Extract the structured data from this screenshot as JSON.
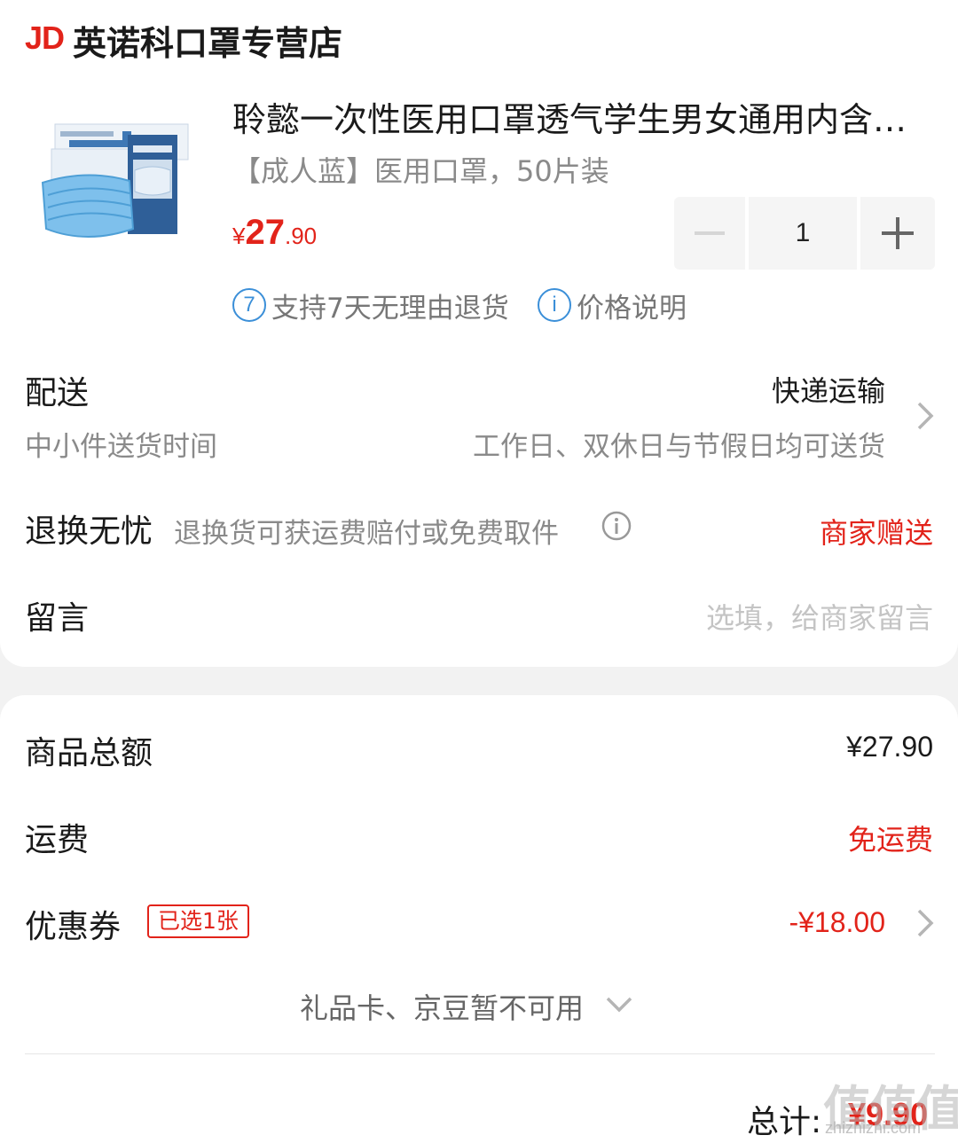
{
  "shop": {
    "logo": "JD",
    "name": "英诺科口罩专营店"
  },
  "product": {
    "title": "聆懿一次性医用口罩透气学生男女通用内含…",
    "spec": "【成人蓝】医用口罩，50片装",
    "price_symbol": "¥",
    "price_int": "27",
    "price_dec": ".90",
    "quantity": "1",
    "services": [
      {
        "icon_text": "7",
        "label": "支持7天无理由退货"
      },
      {
        "icon_text": "i",
        "label": "价格说明"
      }
    ]
  },
  "delivery": {
    "label": "配送",
    "value": "快递运输",
    "sub_label": "中小件送货时间",
    "sub_value": "工作日、双休日与节假日均可送货"
  },
  "returns": {
    "label": "退换无忧",
    "desc": "退换货可获运费赔付或免费取件",
    "value": "商家赠送"
  },
  "message": {
    "label": "留言",
    "placeholder": "选填，给商家留言"
  },
  "summary": {
    "goods_total_label": "商品总额",
    "goods_total_value": "¥27.90",
    "shipping_label": "运费",
    "shipping_value": "免运费",
    "coupon_label": "优惠券",
    "coupon_badge": "已选1张",
    "coupon_value": "-¥18.00",
    "giftcard_text": "礼品卡、京豆暂不可用",
    "total_label": "总计:",
    "total_value": "¥9.90"
  },
  "watermark": {
    "text": "值值值",
    "sub": "zhizhizhi.com"
  },
  "colors": {
    "accent": "#e2231a",
    "info_blue": "#3b8fd8",
    "muted": "#8a8a8a"
  }
}
